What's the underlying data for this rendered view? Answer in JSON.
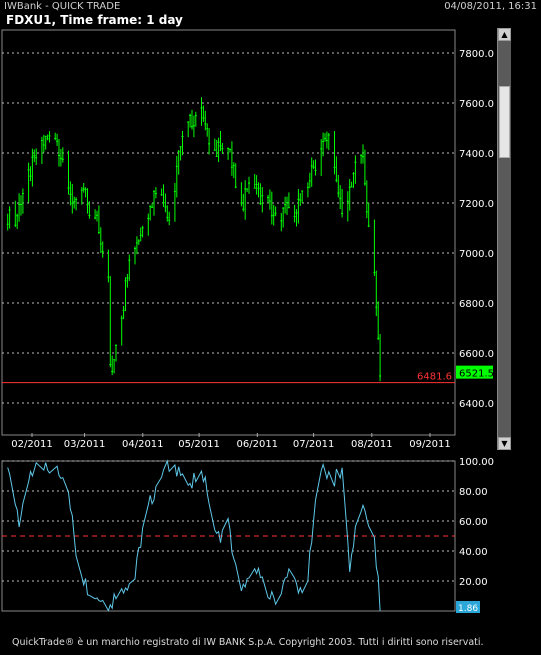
{
  "window": {
    "app_title": "IWBank - QUICK TRADE",
    "datetime": "04/08/2011, 16:31",
    "chart_title": "FDXU1, Time frame: 1 day"
  },
  "footer": {
    "copyright": "QuickTrade® è un marchio registrato di IW BANK S.p.A. Copyright 2003. Tutti i diritti sono riservati."
  },
  "colors": {
    "background": "#000000",
    "price_candles": "#00ff00",
    "support_line": "#ff3333",
    "oscillator_line": "#5ec8e8",
    "oscillator_midline": "#ff3333",
    "gridlines": "#bbbbbb",
    "current_price_box": "#00ff00",
    "oscillator_box": "#2aa7d8"
  },
  "icons": {
    "scroll_up": "scroll-up-arrow-icon",
    "scroll_down": "scroll-down-arrow-icon"
  },
  "chart_data": [
    {
      "type": "candlestick",
      "title": "FDXU1, Time frame: 1 day",
      "x_tick_labels": [
        "02/2011",
        "03/2011",
        "04/2011",
        "05/2011",
        "06/2011",
        "07/2011",
        "08/2011",
        "09/2011"
      ],
      "y_tick_labels": [
        "6400.0",
        "6600.0",
        "6800.0",
        "7000.0",
        "7200.0",
        "7400.0",
        "7600.0",
        "7800.0"
      ],
      "y_ticks": [
        6400,
        6600,
        6800,
        7000,
        7200,
        7400,
        7600,
        7800
      ],
      "ylim": [
        6280,
        7900
      ],
      "grid": true,
      "support_level": 6481.6,
      "support_label": "6481.6",
      "current_price": 6521.5,
      "current_price_label": "6521.5",
      "series": [
        {
          "name": "FDXU1",
          "x": [
            "2011-01-20",
            "2011-01-24",
            "2011-01-28",
            "2011-02-01",
            "2011-02-07",
            "2011-02-14",
            "2011-02-18",
            "2011-02-22",
            "2011-02-25",
            "2011-03-01",
            "2011-03-04",
            "2011-03-08",
            "2011-03-11",
            "2011-03-14",
            "2011-03-15",
            "2011-03-16",
            "2011-03-18",
            "2011-03-22",
            "2011-03-25",
            "2011-03-30",
            "2011-04-05",
            "2011-04-08",
            "2011-04-12",
            "2011-04-15",
            "2011-04-18",
            "2011-04-21",
            "2011-04-26",
            "2011-04-29",
            "2011-05-02",
            "2011-05-05",
            "2011-05-09",
            "2011-05-12",
            "2011-05-16",
            "2011-05-20",
            "2011-05-24",
            "2011-05-27",
            "2011-06-01",
            "2011-06-06",
            "2011-06-10",
            "2011-06-15",
            "2011-06-20",
            "2011-06-24",
            "2011-06-29",
            "2011-07-04",
            "2011-07-08",
            "2011-07-12",
            "2011-07-15",
            "2011-07-19",
            "2011-07-22",
            "2011-07-26",
            "2011-07-29",
            "2011-08-01",
            "2011-08-02",
            "2011-08-03",
            "2011-08-04"
          ],
          "close": [
            7150,
            7120,
            7250,
            7330,
            7440,
            7470,
            7380,
            7240,
            7180,
            7250,
            7170,
            7150,
            7020,
            6900,
            6560,
            6500,
            6650,
            6800,
            7000,
            7060,
            7180,
            7260,
            7230,
            7140,
            7250,
            7450,
            7520,
            7550,
            7610,
            7470,
            7380,
            7460,
            7420,
            7280,
            7210,
            7300,
            7240,
            7200,
            7140,
            7170,
            7180,
            7220,
            7320,
            7420,
            7460,
            7270,
            7180,
            7230,
            7340,
            7370,
            7100,
            6950,
            6750,
            6650,
            6521.5
          ]
        }
      ]
    },
    {
      "type": "line",
      "title": "",
      "y_tick_labels": [
        "20.00",
        "40.00",
        "60.00",
        "80.00",
        "100.00"
      ],
      "y_ticks": [
        20,
        40,
        60,
        80,
        100
      ],
      "ylim": [
        0,
        100
      ],
      "midline": 50,
      "current_value_label": "1.86",
      "series": [
        {
          "name": "",
          "x": [
            "2011-01-20",
            "2011-01-26",
            "2011-02-01",
            "2011-02-07",
            "2011-02-14",
            "2011-02-20",
            "2011-02-25",
            "2011-03-02",
            "2011-03-08",
            "2011-03-12",
            "2011-03-15",
            "2011-03-18",
            "2011-03-23",
            "2011-03-28",
            "2011-04-01",
            "2011-04-05",
            "2011-04-12",
            "2011-04-18",
            "2011-04-22",
            "2011-04-26",
            "2011-05-02",
            "2011-05-06",
            "2011-05-10",
            "2011-05-16",
            "2011-05-20",
            "2011-05-25",
            "2011-05-30",
            "2011-06-03",
            "2011-06-08",
            "2011-06-13",
            "2011-06-17",
            "2011-06-22",
            "2011-06-27",
            "2011-07-01",
            "2011-07-05",
            "2011-07-11",
            "2011-07-15",
            "2011-07-19",
            "2011-07-22",
            "2011-07-27",
            "2011-08-01",
            "2011-08-04"
          ],
          "values": [
            95,
            62,
            94,
            92,
            98,
            88,
            40,
            18,
            10,
            6,
            3,
            12,
            18,
            22,
            55,
            72,
            98,
            92,
            97,
            80,
            98,
            75,
            48,
            58,
            28,
            12,
            34,
            18,
            8,
            12,
            26,
            12,
            22,
            70,
            95,
            88,
            92,
            30,
            52,
            68,
            48,
            1.86
          ]
        }
      ]
    }
  ]
}
